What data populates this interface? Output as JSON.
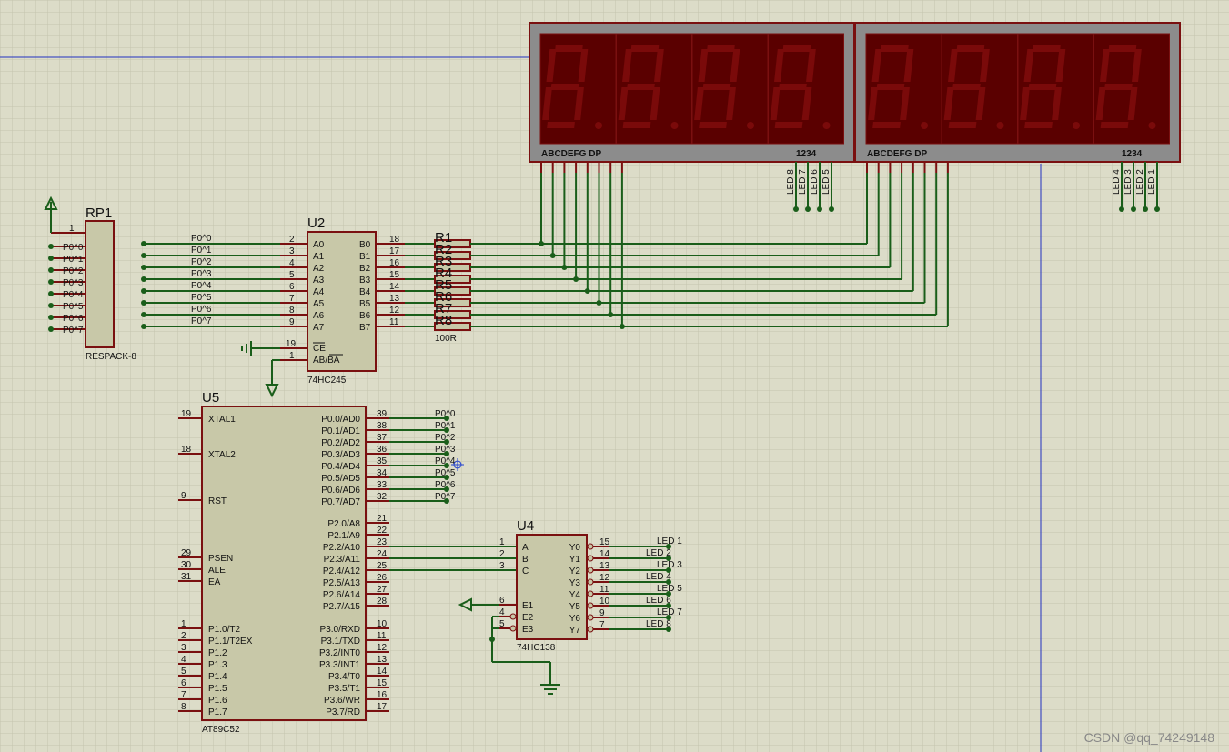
{
  "watermark": "CSDN @qq_74249148",
  "rp1": {
    "ref": "RP1",
    "value": "RESPACK-8",
    "pin1": "1",
    "labels": [
      "P0^0",
      "P0^1",
      "P0^2",
      "P0^3",
      "P0^4",
      "P0^5",
      "P0^6",
      "P0^7"
    ]
  },
  "u2": {
    "ref": "U2",
    "value": "74HC245",
    "a_pins": [
      "A0",
      "A1",
      "A2",
      "A3",
      "A4",
      "A5",
      "A6",
      "A7"
    ],
    "b_pins": [
      "B0",
      "B1",
      "B2",
      "B3",
      "B4",
      "B5",
      "B6",
      "B7"
    ],
    "a_nums": [
      "2",
      "3",
      "4",
      "5",
      "6",
      "7",
      "8",
      "9"
    ],
    "b_nums": [
      "18",
      "17",
      "16",
      "15",
      "14",
      "13",
      "12",
      "11"
    ],
    "ce": "CE",
    "abba": "AB/BA",
    "ce_num": "19",
    "abba_num": "1",
    "net_labels": [
      "P0^0",
      "P0^1",
      "P0^2",
      "P0^3",
      "P0^4",
      "P0^5",
      "P0^6",
      "P0^7"
    ]
  },
  "resistors": {
    "refs": [
      "R1",
      "R2",
      "R3",
      "R4",
      "R5",
      "R6",
      "R7",
      "R8"
    ],
    "value": "100R"
  },
  "display": {
    "seg_label": "ABCDEFG  DP",
    "digit_label": "1234",
    "left_leds": [
      "LED 8",
      "LED 7",
      "LED 6",
      "LED 5"
    ],
    "right_leds": [
      "LED 4",
      "LED 3",
      "LED 2",
      "LED 1"
    ]
  },
  "u5": {
    "ref": "U5",
    "value": "AT89C52",
    "left_pins": [
      {
        "num": "19",
        "name": "XTAL1"
      },
      {
        "num": "18",
        "name": "XTAL2"
      },
      {
        "num": "9",
        "name": "RST"
      },
      {
        "num": "29",
        "name": "PSEN"
      },
      {
        "num": "30",
        "name": "ALE"
      },
      {
        "num": "31",
        "name": "EA"
      },
      {
        "num": "1",
        "name": "P1.0/T2"
      },
      {
        "num": "2",
        "name": "P1.1/T2EX"
      },
      {
        "num": "3",
        "name": "P1.2"
      },
      {
        "num": "4",
        "name": "P1.3"
      },
      {
        "num": "5",
        "name": "P1.4"
      },
      {
        "num": "6",
        "name": "P1.5"
      },
      {
        "num": "7",
        "name": "P1.6"
      },
      {
        "num": "8",
        "name": "P1.7"
      }
    ],
    "p0_pins": [
      {
        "num": "39",
        "name": "P0.0/AD0"
      },
      {
        "num": "38",
        "name": "P0.1/AD1"
      },
      {
        "num": "37",
        "name": "P0.2/AD2"
      },
      {
        "num": "36",
        "name": "P0.3/AD3"
      },
      {
        "num": "35",
        "name": "P0.4/AD4"
      },
      {
        "num": "34",
        "name": "P0.5/AD5"
      },
      {
        "num": "33",
        "name": "P0.6/AD6"
      },
      {
        "num": "32",
        "name": "P0.7/AD7"
      }
    ],
    "p2_pins": [
      {
        "num": "21",
        "name": "P2.0/A8"
      },
      {
        "num": "22",
        "name": "P2.1/A9"
      },
      {
        "num": "23",
        "name": "P2.2/A10"
      },
      {
        "num": "24",
        "name": "P2.3/A11"
      },
      {
        "num": "25",
        "name": "P2.4/A12"
      },
      {
        "num": "26",
        "name": "P2.5/A13"
      },
      {
        "num": "27",
        "name": "P2.6/A14"
      },
      {
        "num": "28",
        "name": "P2.7/A15"
      }
    ],
    "p3_pins": [
      {
        "num": "10",
        "name": "P3.0/RXD"
      },
      {
        "num": "11",
        "name": "P3.1/TXD"
      },
      {
        "num": "12",
        "name": "P3.2/INT0"
      },
      {
        "num": "13",
        "name": "P3.3/INT1"
      },
      {
        "num": "14",
        "name": "P3.4/T0"
      },
      {
        "num": "15",
        "name": "P3.5/T1"
      },
      {
        "num": "16",
        "name": "P3.6/WR"
      },
      {
        "num": "17",
        "name": "P3.7/RD"
      }
    ],
    "p0_net_labels": [
      "P0^0",
      "P0^1",
      "P0^2",
      "P0^3",
      "P0^4",
      "P0^5",
      "P0^6",
      "P0^7"
    ]
  },
  "u4": {
    "ref": "U4",
    "value": "74HC138",
    "inputs": [
      {
        "num": "1",
        "name": "A"
      },
      {
        "num": "2",
        "name": "B"
      },
      {
        "num": "3",
        "name": "C"
      }
    ],
    "enables": [
      {
        "num": "6",
        "name": "E1"
      },
      {
        "num": "4",
        "name": "E2"
      },
      {
        "num": "5",
        "name": "E3"
      }
    ],
    "outputs": [
      {
        "num": "15",
        "name": "Y0",
        "net": "LED 1"
      },
      {
        "num": "14",
        "name": "Y1",
        "net": "LED 2"
      },
      {
        "num": "13",
        "name": "Y2",
        "net": "LED 3"
      },
      {
        "num": "12",
        "name": "Y3",
        "net": "LED 4"
      },
      {
        "num": "11",
        "name": "Y4",
        "net": "LED 5"
      },
      {
        "num": "10",
        "name": "Y5",
        "net": "LED 6"
      },
      {
        "num": "9",
        "name": "Y6",
        "net": "LED 7"
      },
      {
        "num": "7",
        "name": "Y7",
        "net": "LED 8"
      }
    ]
  }
}
